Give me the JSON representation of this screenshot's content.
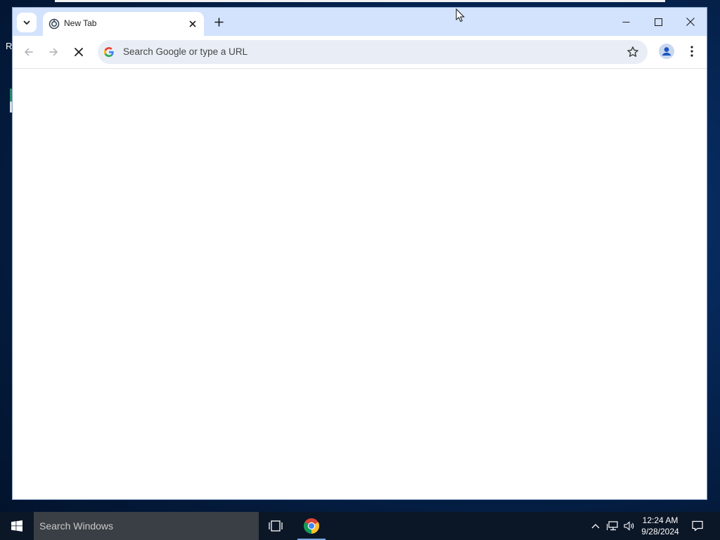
{
  "desktop": {
    "partial_label": "R"
  },
  "browser": {
    "tabs": [
      {
        "title": "New Tab",
        "active": true,
        "favicon": "chrome-newtab-icon"
      }
    ],
    "window_controls": [
      "minimize-icon",
      "maximize-icon",
      "close-icon"
    ],
    "omnibox": {
      "placeholder": "Search Google or type a URL",
      "value": ""
    },
    "loading": true,
    "colors": {
      "tabstrip": "#d3e3fd",
      "omnibox_bg": "#e9eef6",
      "profile": "#1a56c4"
    }
  },
  "taskbar": {
    "search_placeholder": "Search Windows",
    "pinned": [
      "task-view-icon",
      "chrome-icon"
    ],
    "tray_icons": [
      "chevron-up-icon",
      "network-icon",
      "volume-icon"
    ],
    "clock": {
      "time": "12:24 AM",
      "date": "9/28/2024"
    }
  }
}
